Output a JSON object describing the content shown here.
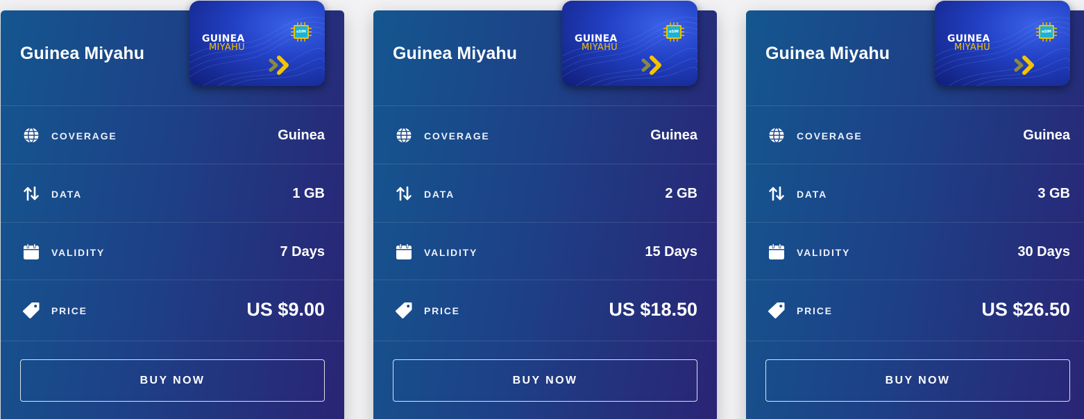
{
  "labels": {
    "coverage": "COVERAGE",
    "data": "DATA",
    "validity": "VALIDITY",
    "price": "PRICE",
    "buy": "BUY NOW"
  },
  "sim_card": {
    "line1": "GUINEA",
    "line2": "MIYAHU",
    "chip_text": "eSIM"
  },
  "colors": {
    "card_gradient_start": "#14568f",
    "card_gradient_end": "#2a2475",
    "sim_accent": "#f5c300"
  },
  "cards": [
    {
      "title": "Guinea Miyahu",
      "coverage": "Guinea",
      "data": "1 GB",
      "validity": "7 Days",
      "price": "US $9.00"
    },
    {
      "title": "Guinea Miyahu",
      "coverage": "Guinea",
      "data": "2 GB",
      "validity": "15 Days",
      "price": "US $18.50"
    },
    {
      "title": "Guinea Miyahu",
      "coverage": "Guinea",
      "data": "3 GB",
      "validity": "30 Days",
      "price": "US $26.50"
    }
  ]
}
